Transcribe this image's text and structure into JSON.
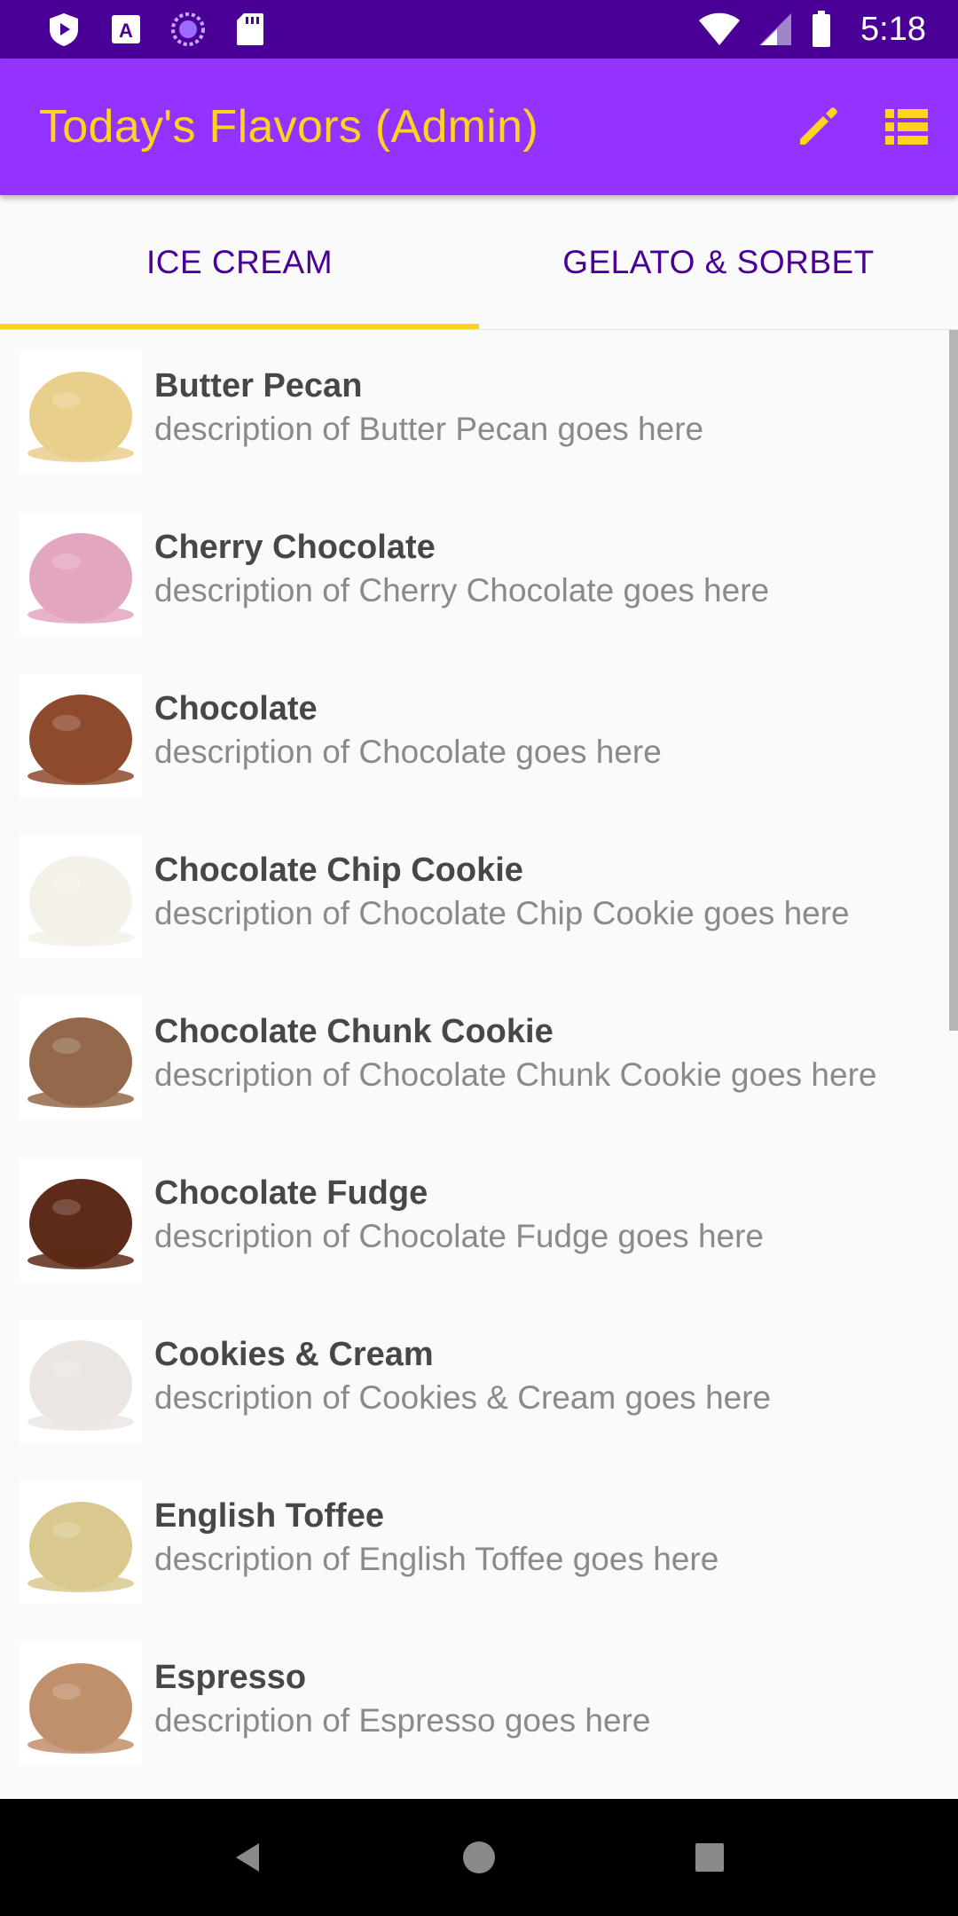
{
  "status_bar": {
    "time": "5:18",
    "icons": [
      "play-protect-icon",
      "a-badge-icon",
      "sync-circle-icon",
      "sd-card-icon",
      "wifi-icon",
      "signal-icon",
      "battery-icon"
    ]
  },
  "app_bar": {
    "title": "Today's Flavors (Admin)",
    "actions": [
      "edit-icon",
      "list-icon"
    ]
  },
  "tabs": [
    {
      "label": "ICE CREAM",
      "active": true
    },
    {
      "label": "GELATO & SORBET",
      "active": false
    }
  ],
  "flavors": [
    {
      "name": "Butter Pecan",
      "description": "description of Butter Pecan goes here",
      "color": "#e9cf8c"
    },
    {
      "name": "Cherry Chocolate",
      "description": "description of Cherry Chocolate goes here",
      "color": "#e3a6c0"
    },
    {
      "name": "Chocolate",
      "description": "description of Chocolate goes here",
      "color": "#8e4a2c"
    },
    {
      "name": "Chocolate Chip Cookie",
      "description": "description of Chocolate Chip Cookie goes here",
      "color": "#f3f1e8"
    },
    {
      "name": "Chocolate Chunk Cookie",
      "description": "description of Chocolate Chunk Cookie goes here",
      "color": "#93684b"
    },
    {
      "name": "Chocolate Fudge",
      "description": "description of Chocolate Fudge goes here",
      "color": "#5e2a19"
    },
    {
      "name": "Cookies & Cream",
      "description": "description of Cookies & Cream goes here",
      "color": "#ece6e3"
    },
    {
      "name": "English Toffee",
      "description": "description of English Toffee goes here",
      "color": "#d9c98e"
    },
    {
      "name": "Espresso",
      "description": "description of Espresso goes here",
      "color": "#c0906c"
    }
  ],
  "nav_bar": {
    "buttons": [
      "back-icon",
      "home-icon",
      "recents-icon"
    ]
  },
  "colors": {
    "status_bar": "#4a0096",
    "app_bar": "#9333ff",
    "accent": "#ffd21f",
    "tab_text": "#4a0096"
  }
}
